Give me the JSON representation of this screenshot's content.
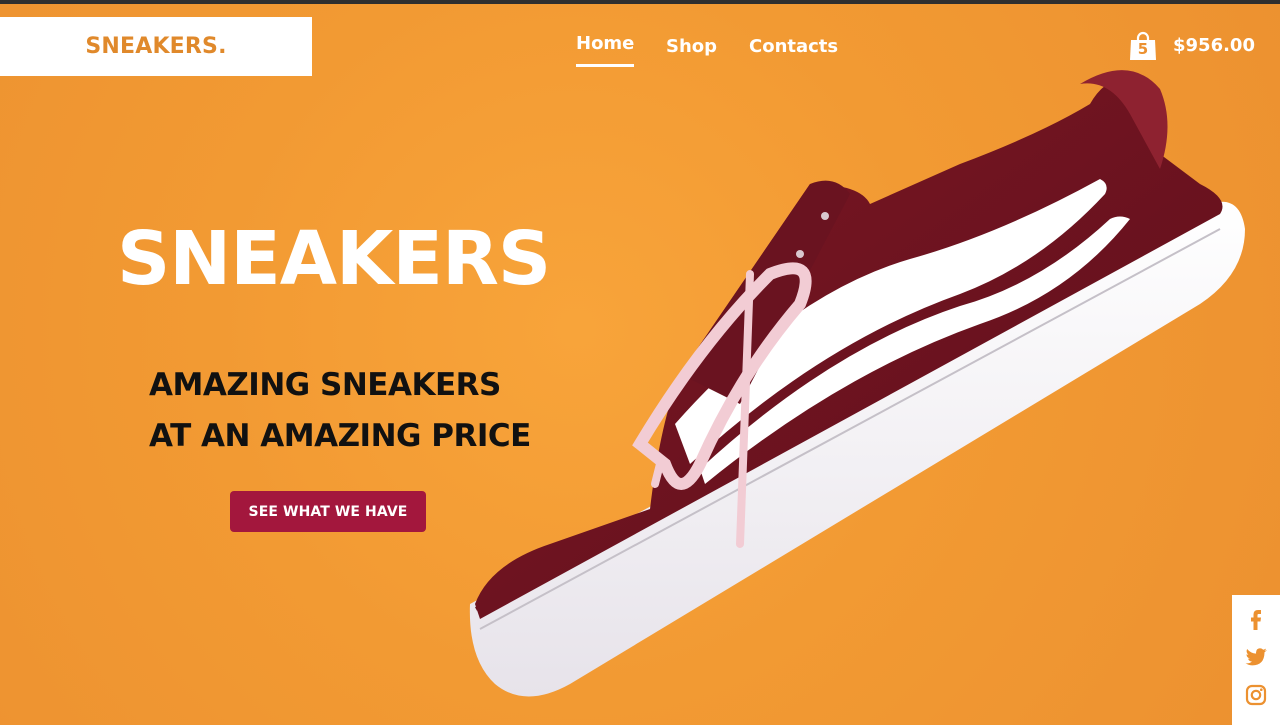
{
  "brand": {
    "logo": "SNEAKERS.",
    "accent_color": "#ec9130",
    "cta_color": "#a3173d"
  },
  "nav": {
    "items": [
      {
        "label": "Home",
        "active": true
      },
      {
        "label": "Shop",
        "active": false
      },
      {
        "label": "Contacts",
        "active": false
      }
    ]
  },
  "cart": {
    "icon": "shopping-bag-icon",
    "count": "5",
    "total": "$956.00"
  },
  "hero": {
    "title": "SNEAKERS",
    "subtitle_line1": "AMAZING SNEAKERS",
    "subtitle_line2": "AT AN AMAZING PRICE",
    "cta_label": "SEE WHAT WE HAVE",
    "image": "maroon-low-top-sneaker-photo"
  },
  "social": [
    {
      "name": "facebook-icon"
    },
    {
      "name": "twitter-icon"
    },
    {
      "name": "instagram-icon"
    }
  ]
}
